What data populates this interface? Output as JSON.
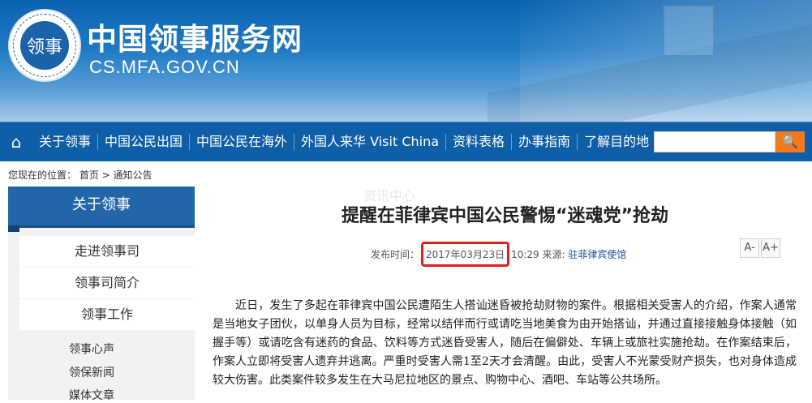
{
  "header": {
    "title": "中国领事服务网",
    "url": "CS.MFA.GOV.CN",
    "emblem_text": "领事"
  },
  "nav": {
    "home_icon": "home-icon",
    "items": [
      "关于领事",
      "中国公民出国",
      "中国公民在海外",
      "外国人来华 Visit China",
      "资料表格",
      "办事指南",
      "了解目的地"
    ],
    "search_placeholder": "",
    "search_icon": "search-icon"
  },
  "breadcrumb": "您现在的位置： 首页 > 通知公告",
  "sidebar": {
    "heading": "关于领事",
    "items": [
      "走进领事司",
      "领事司简介",
      "领事工作"
    ],
    "subitems": [
      "领事心声",
      "领保新闻",
      "媒体文章"
    ]
  },
  "article": {
    "watermark": "资讯中心",
    "title": "提醒在菲律宾中国公民警惕“迷魂党”抢劫",
    "meta_label": "发布时间：",
    "date": "2017年03月23日",
    "time_and_source_label": "10:29 来源:",
    "source": "驻菲律宾使馆",
    "font_smaller": "A-",
    "font_larger": "A+",
    "body": "近日，发生了多起在菲律宾中国公民遭陌生人搭讪迷昏被抢劫财物的案件。根据相关受害人的介绍，作案人通常是当地女子团伙，以单身人员为目标，经常以结伴而行或请吃当地美食为由开始搭讪，并通过直接接触身体接触（如握手等）或请吃含有迷药的食品、饮料等方式迷昏受害人，随后在偏僻处、车辆上或旅社实施抢劫。在作案结束后，作案人立即将受害人遗弃并逃离。严重时受害人需1至2天才会清醒。由此，受害人不光蒙受财产损失，也对身体造成较大伤害。此类案件较多发生在大马尼拉地区的景点、购物中心、酒吧、车站等公共场所。"
  },
  "colors": {
    "nav_bg": "#0f5ea8",
    "search_button": "#f07a1e",
    "highlight_box": "#e0201c",
    "sidebar_head": "#2366a8"
  }
}
